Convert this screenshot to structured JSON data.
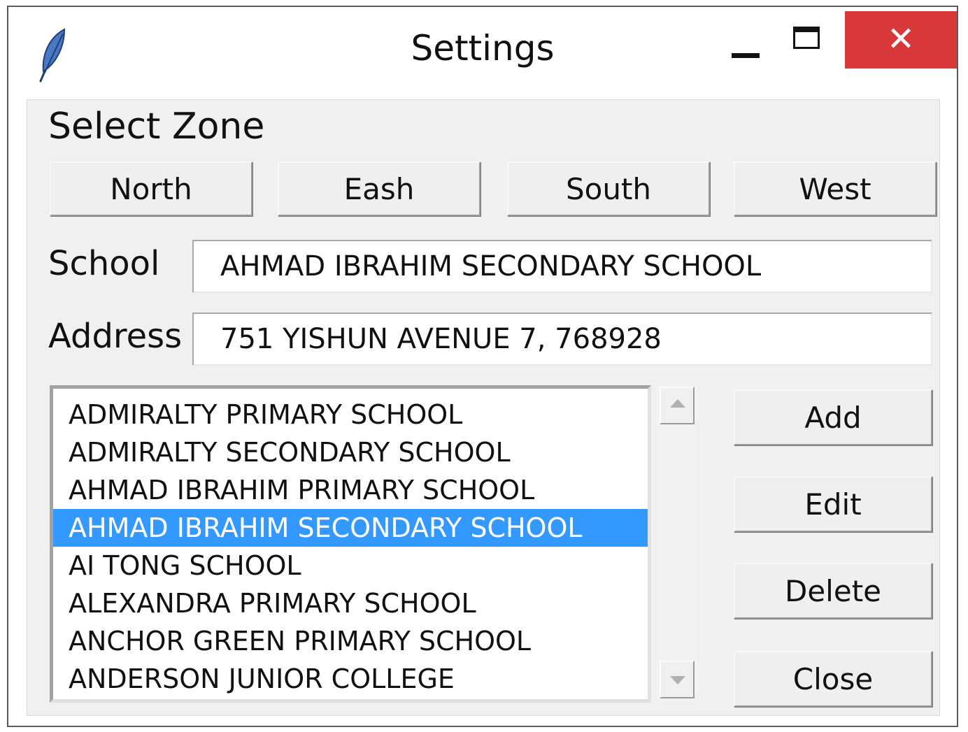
{
  "window": {
    "title": "Settings",
    "close_glyph": "✕",
    "icons": {
      "app": "feather-icon",
      "minimize": "minimize-icon",
      "maximize": "maximize-icon",
      "close": "close-icon"
    }
  },
  "zone": {
    "label": "Select Zone",
    "buttons": [
      "North",
      "Eash",
      "South",
      "West"
    ]
  },
  "school": {
    "label": "School",
    "value": "AHMAD IBRAHIM SECONDARY SCHOOL"
  },
  "address": {
    "label": "Address",
    "value": "751 YISHUN AVENUE 7, 768928"
  },
  "list": {
    "items": [
      "ADMIRALTY PRIMARY SCHOOL",
      "ADMIRALTY SECONDARY SCHOOL",
      "AHMAD IBRAHIM PRIMARY SCHOOL",
      "AHMAD IBRAHIM SECONDARY SCHOOL",
      "AI TONG SCHOOL",
      "ALEXANDRA PRIMARY SCHOOL",
      "ANCHOR GREEN PRIMARY SCHOOL",
      "ANDERSON JUNIOR COLLEGE"
    ],
    "selected_index": 3
  },
  "actions": {
    "add": "Add",
    "edit": "Edit",
    "delete": "Delete",
    "close": "Close"
  },
  "colors": {
    "selection": "#3399ff",
    "close_button": "#d9383b"
  }
}
